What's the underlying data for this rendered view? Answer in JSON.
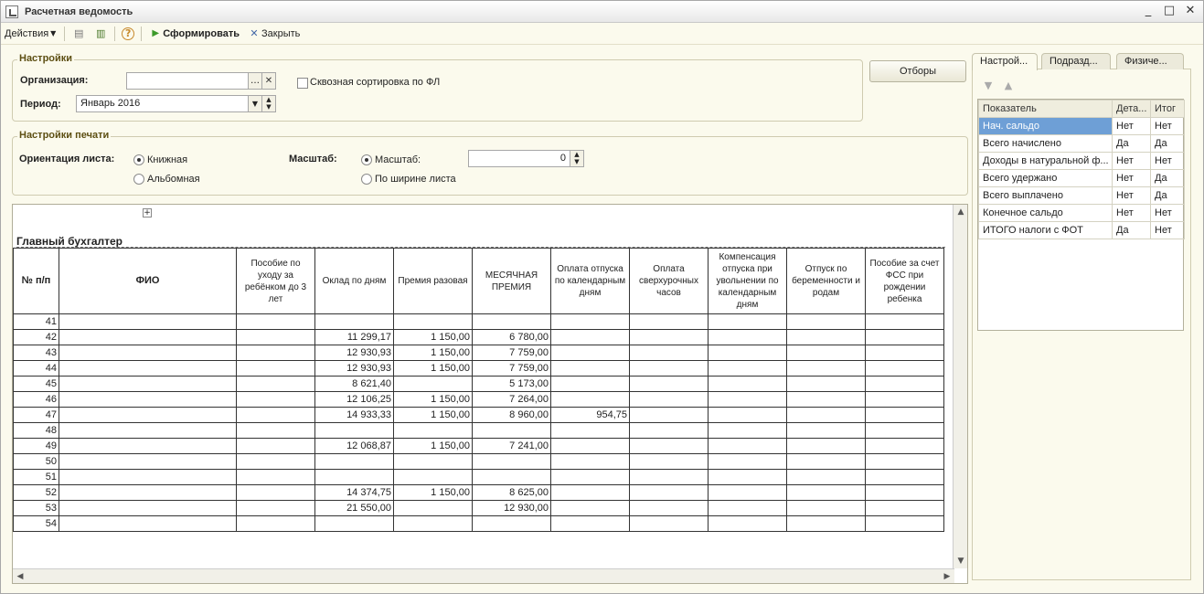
{
  "window": {
    "title": "Расчетная ведомость",
    "controls": [
      "_",
      "□",
      "✕"
    ]
  },
  "toolbar": {
    "actions_label": "Действия",
    "generate_label": "Сформировать",
    "close_label": "Закрыть",
    "help_symbol": "?"
  },
  "settings": {
    "group_title": "Настройки",
    "org_label": "Организация:",
    "org_value": "",
    "period_label": "Период:",
    "period_value": "Январь 2016",
    "cross_sort_label": "Сквозная сортировка по ФЛ",
    "filters_button": "Отборы"
  },
  "print_settings": {
    "group_title": "Настройки печати",
    "orientation_label": "Ориентация листа:",
    "portrait_label": "Книжная",
    "landscape_label": "Альбомная",
    "scale_label": "Масштаб:",
    "scale_option_label": "Масштаб:",
    "fit_width_label": "По ширине листа",
    "scale_value": "0"
  },
  "report": {
    "title": "Главный бухгалтер",
    "columns": [
      "№ п/п",
      "ФИО",
      "Пособие по уходу за ребёнком до 3 лет",
      "Оклад по дням",
      "Премия разовая",
      "МЕСЯЧНАЯ ПРЕМИЯ",
      "Оплата отпуска по календарным дням",
      "Оплата сверхурочных часов",
      "Компенсация отпуска при увольнении по календарным дням",
      "Отпуск по беременности и родам",
      "Пособие за счет ФСС при рождении ребенка"
    ],
    "rows": [
      {
        "n": "41",
        "fio": "",
        "c2": "",
        "c3": "",
        "c4": "",
        "c5": "",
        "c6": ""
      },
      {
        "n": "42",
        "fio": "",
        "c2": "",
        "c3": "11 299,17",
        "c4": "1 150,00",
        "c5": "6 780,00",
        "c6": ""
      },
      {
        "n": "43",
        "fio": "",
        "c2": "",
        "c3": "12 930,93",
        "c4": "1 150,00",
        "c5": "7 759,00",
        "c6": ""
      },
      {
        "n": "44",
        "fio": "",
        "c2": "",
        "c3": "12 930,93",
        "c4": "1 150,00",
        "c5": "7 759,00",
        "c6": ""
      },
      {
        "n": "45",
        "fio": "",
        "c2": "",
        "c3": "8 621,40",
        "c4": "",
        "c5": "5 173,00",
        "c6": ""
      },
      {
        "n": "46",
        "fio": "",
        "c2": "",
        "c3": "12 106,25",
        "c4": "1 150,00",
        "c5": "7 264,00",
        "c6": ""
      },
      {
        "n": "47",
        "fio": "",
        "c2": "",
        "c3": "14 933,33",
        "c4": "1 150,00",
        "c5": "8 960,00",
        "c6": "954,75"
      },
      {
        "n": "48",
        "fio": "",
        "c2": "",
        "c3": "",
        "c4": "",
        "c5": "",
        "c6": ""
      },
      {
        "n": "49",
        "fio": "",
        "c2": "",
        "c3": "12 068,87",
        "c4": "1 150,00",
        "c5": "7 241,00",
        "c6": ""
      },
      {
        "n": "50",
        "fio": "",
        "c2": "",
        "c3": "",
        "c4": "",
        "c5": "",
        "c6": ""
      },
      {
        "n": "51",
        "fio": "",
        "c2": "",
        "c3": "",
        "c4": "",
        "c5": "",
        "c6": ""
      },
      {
        "n": "52",
        "fio": "",
        "c2": "",
        "c3": "14 374,75",
        "c4": "1 150,00",
        "c5": "8 625,00",
        "c6": ""
      },
      {
        "n": "53",
        "fio": "",
        "c2": "",
        "c3": "21 550,00",
        "c4": "",
        "c5": "12 930,00",
        "c6": ""
      },
      {
        "n": "54",
        "fio": "",
        "c2": "",
        "c3": "",
        "c4": "",
        "c5": "",
        "c6": ""
      }
    ]
  },
  "right_panel": {
    "tabs": [
      "Настрой...",
      "Подразд...",
      "Физиче..."
    ],
    "headers": [
      "Показатель",
      "Дета...",
      "Итог"
    ],
    "rows": [
      {
        "name": "Нач. сальдо",
        "detail": "Нет",
        "total": "Нет"
      },
      {
        "name": "Всего начислено",
        "detail": "Да",
        "total": "Да"
      },
      {
        "name": "Доходы в натуральной ф...",
        "detail": "Нет",
        "total": "Нет"
      },
      {
        "name": "Всего удержано",
        "detail": "Нет",
        "total": "Да"
      },
      {
        "name": "Всего выплачено",
        "detail": "Нет",
        "total": "Да"
      },
      {
        "name": "Конечное сальдо",
        "detail": "Нет",
        "total": "Нет"
      },
      {
        "name": "ИТОГО налоги с ФОТ",
        "detail": "Да",
        "total": "Нет"
      }
    ]
  }
}
